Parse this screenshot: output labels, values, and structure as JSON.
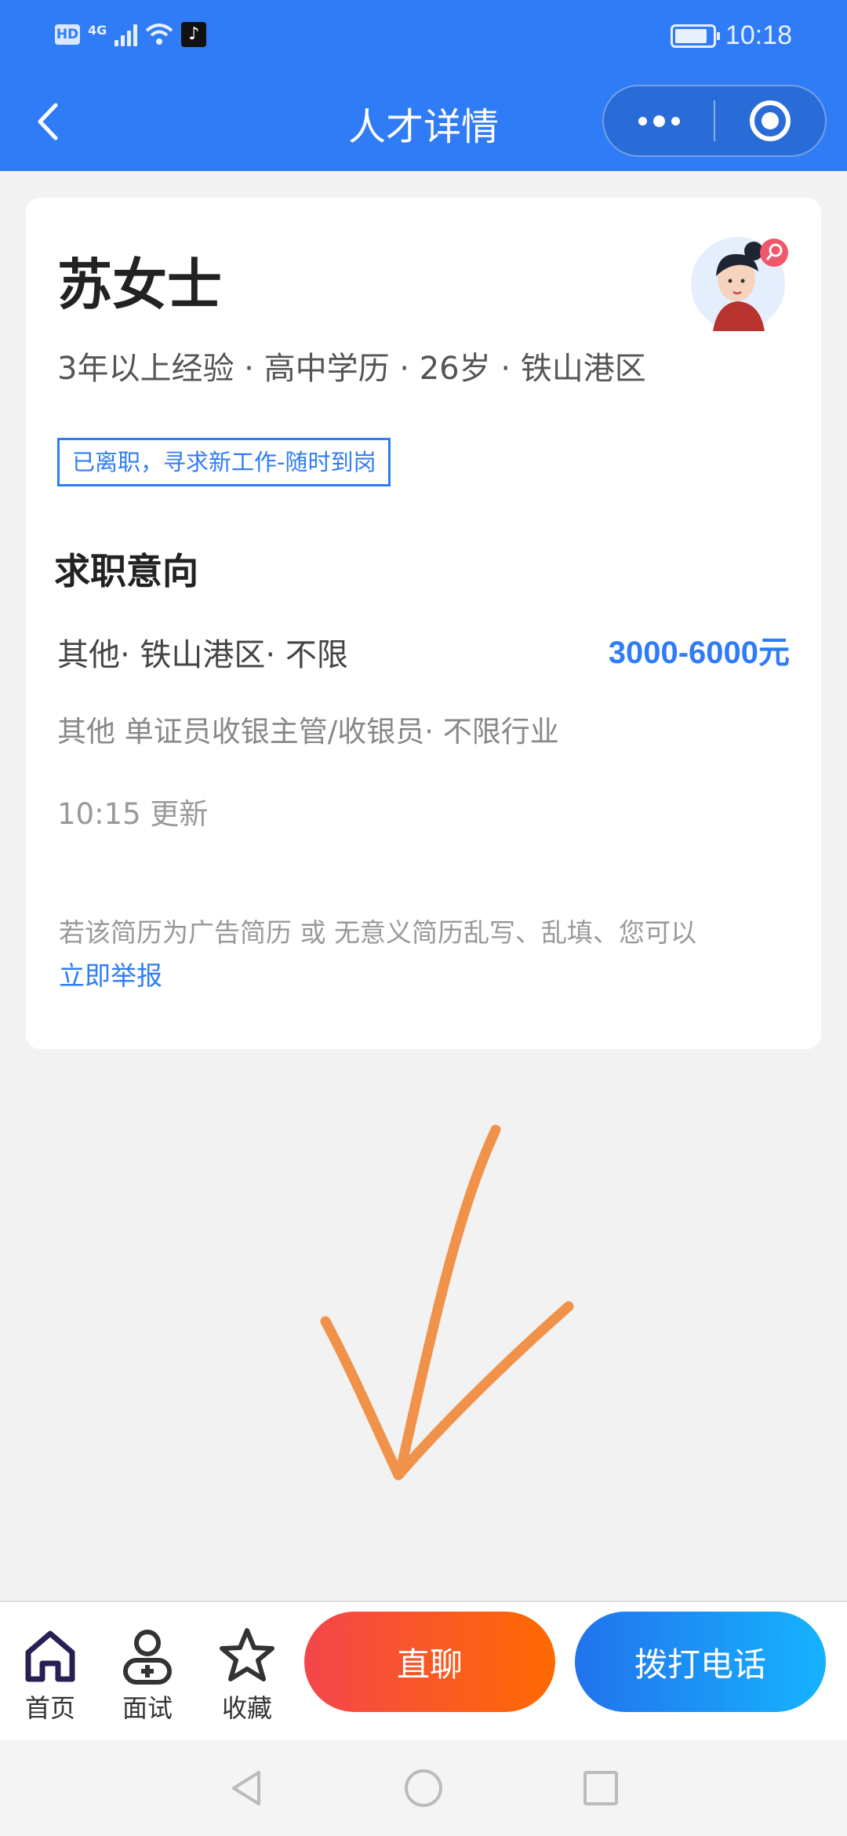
{
  "status_bar": {
    "hd_label": "HD",
    "network_label": "4G",
    "time": "10:18"
  },
  "nav": {
    "title": "人才详情"
  },
  "profile": {
    "name": "苏女士",
    "meta": "3年以上经验 · 高中学历 · 26岁 · 铁山港区",
    "status_tag": "已离职，寻求新工作-随时到岗",
    "section_title": "求职意向",
    "intent": "其他· 铁山港区· 不限",
    "salary": "3000-6000元",
    "jobs": "其他 单证员收银主管/收银员· 不限行业",
    "updated": "10:15 更新",
    "report_text": "若该简历为广告简历 或 无意义简历乱写、乱填、您可以",
    "report_link": "立即举报"
  },
  "bottom_bar": {
    "tabs": [
      {
        "label": "首页",
        "icon": "home-icon"
      },
      {
        "label": "面试",
        "icon": "interview-person-icon"
      },
      {
        "label": "收藏",
        "icon": "star-icon"
      }
    ],
    "chat_button": "直聊",
    "call_button": "拨打电话"
  },
  "colors": {
    "primary": "#2f7cf6",
    "chat_gradient": [
      "#f4464c",
      "#ff6a00"
    ],
    "call_gradient": [
      "#2273ec",
      "#16b3ff"
    ],
    "arrow": "#f0924a"
  }
}
